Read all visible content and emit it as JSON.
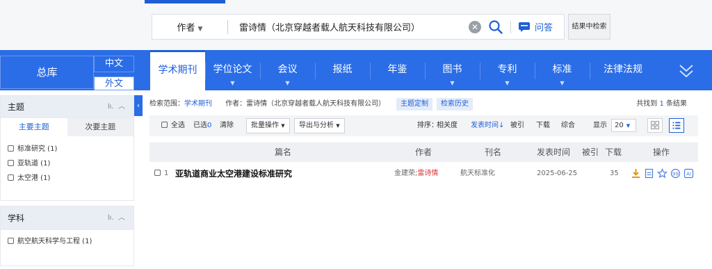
{
  "search": {
    "field": "作者",
    "query": "雷诗情（北京穿越者载人航天科技有限公司）",
    "qa_label": "问答",
    "in_results_label": "结果中检索"
  },
  "library": {
    "main": "总库",
    "cn": "中文",
    "en": "外文"
  },
  "tabs": [
    {
      "label": "学术期刊"
    },
    {
      "label": "学位论文"
    },
    {
      "label": "会议"
    },
    {
      "label": "报纸"
    },
    {
      "label": "年鉴"
    },
    {
      "label": "图书"
    },
    {
      "label": "专利"
    },
    {
      "label": "标准"
    },
    {
      "label": "法律法规"
    }
  ],
  "sidebar": {
    "topic": {
      "title": "主题",
      "subtabs": [
        "主要主题",
        "次要主题"
      ],
      "items": [
        "标准研究 (1)",
        "亚轨道 (1)",
        "太空港 (1)"
      ]
    },
    "subject": {
      "title": "学科",
      "items": [
        "航空航天科学与工程 (1)"
      ]
    }
  },
  "scope": {
    "label": "检索范围：",
    "value": "学术期刊",
    "author_label": "作者：",
    "author_value": "雷诗情（北京穿越者载人航天科技有限公司）",
    "topic_custom": "主题定制",
    "history": "检索历史",
    "result_prefix": "共找到",
    "result_count": "1",
    "result_suffix": "条结果"
  },
  "toolbar": {
    "select_all": "全选",
    "selected_prefix": "已选",
    "selected_count": "0",
    "clear": "清除",
    "batch": "批量操作",
    "export": "导出与分析",
    "sort_label": "排序：",
    "sort_options": [
      "相关度",
      "发表时间",
      "被引",
      "下载",
      "综合"
    ],
    "sort_arrow": "↓",
    "show_label": "显示",
    "page_size": "20"
  },
  "table": {
    "headers": [
      "篇名",
      "作者",
      "刊名",
      "发表时间",
      "被引",
      "下载",
      "操作"
    ],
    "rows": [
      {
        "index": "1",
        "title": "亚轨道商业太空港建设标准研究",
        "author_a": "金建荣;",
        "author_b": "雷诗情",
        "journal": "航天标准化",
        "date": "2025-06-25",
        "cited": "",
        "downloads": "35",
        "ops": [
          "download-icon",
          "html-read-icon",
          "favorite-icon",
          "cite-icon",
          "ai-icon"
        ]
      }
    ]
  },
  "colors": {
    "brand_blue": "#2a6de7",
    "link_blue": "#1f5fd6",
    "highlight_red": "#e03535"
  }
}
